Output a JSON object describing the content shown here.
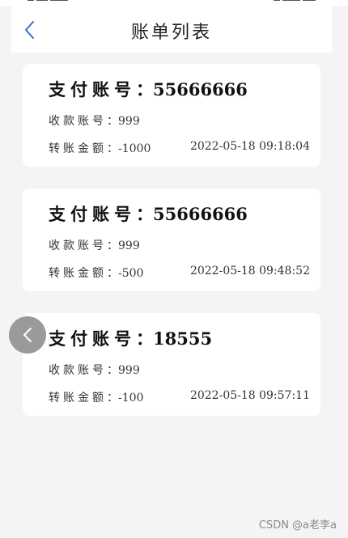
{
  "header": {
    "title": "账单列表"
  },
  "bills": [
    {
      "pay_label": "支付账号",
      "colon": "：",
      "pay_account": "55666666",
      "receive_label": "收款账号",
      "receive_account": "999",
      "amount_label": "转账金额",
      "amount": "-1000",
      "time": "2022-05-18 09:18:04"
    },
    {
      "pay_label": "支付账号",
      "colon": "：",
      "pay_account": "55666666",
      "receive_label": "收款账号",
      "receive_account": "999",
      "amount_label": "转账金额",
      "amount": "-500",
      "time": "2022-05-18 09:48:52"
    },
    {
      "pay_label": "支付账号",
      "colon": "：",
      "pay_account": "18555",
      "receive_label": "收款账号",
      "receive_account": "999",
      "amount_label": "转账金额",
      "amount": "-100",
      "time": "2022-05-18 09:57:11"
    }
  ],
  "small_colon": "：",
  "watermark": "CSDN @a老李a",
  "icons": {
    "back": "chevron-left-icon",
    "float_back": "chevron-left-icon"
  },
  "colors": {
    "accent": "#2f6fd6",
    "float_button": "#9a9a9a"
  }
}
